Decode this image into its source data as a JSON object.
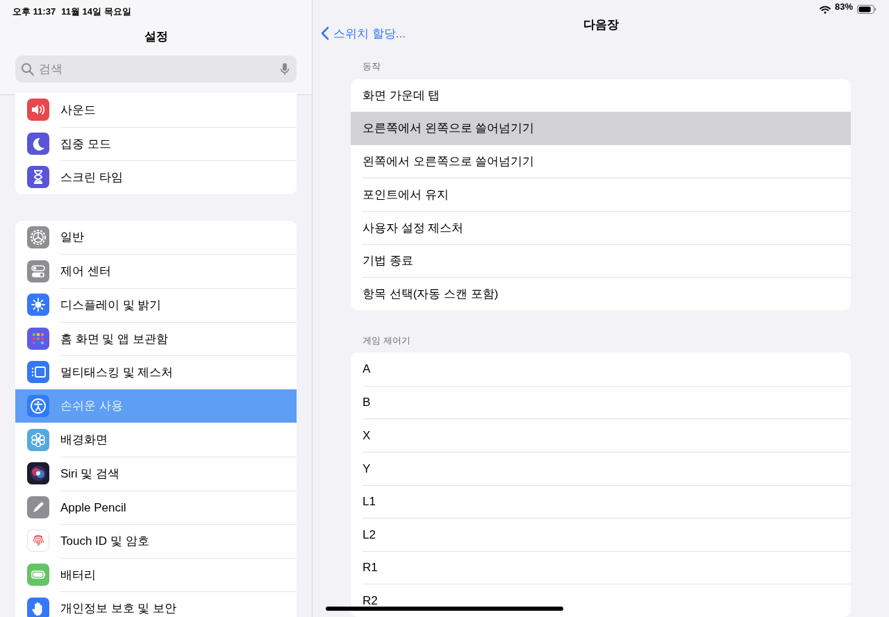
{
  "status_bar": {
    "time": "오후 11:37",
    "date": "11월 14일 목요일",
    "battery": "83%"
  },
  "sidebar": {
    "title": "설정",
    "search": {
      "placeholder": "검색"
    },
    "groups": [
      {
        "items": [
          {
            "label": "사운드",
            "selected": false
          },
          {
            "label": "집중 모드",
            "selected": false
          },
          {
            "label": "스크린 타임",
            "selected": false
          }
        ]
      },
      {
        "items": [
          {
            "label": "일반",
            "selected": false
          },
          {
            "label": "제어 센터",
            "selected": false
          },
          {
            "label": "디스플레이 및 밝기",
            "selected": false
          },
          {
            "label": "홈 화면 및 앱 보관함",
            "selected": false
          },
          {
            "label": "멀티태스킹 및 제스처",
            "selected": false
          },
          {
            "label": "손쉬운 사용",
            "selected": true
          },
          {
            "label": "배경화면",
            "selected": false
          },
          {
            "label": "Siri 및 검색",
            "selected": false
          },
          {
            "label": "Apple Pencil",
            "selected": false
          },
          {
            "label": "Touch ID 및 암호",
            "selected": false
          },
          {
            "label": "배터리",
            "selected": false
          },
          {
            "label": "개인정보 보호 및 보안",
            "selected": false
          }
        ]
      }
    ]
  },
  "detail": {
    "back": "스위치 할당...",
    "title": "다음장",
    "sections": [
      {
        "header": "동작",
        "rows": [
          {
            "label": "화면 가운데 탭",
            "selected": false
          },
          {
            "label": "오른쪽에서 왼쪽으로 쓸어넘기기",
            "selected": true
          },
          {
            "label": "왼쪽에서 오른쪽으로 쓸어넘기기",
            "selected": false
          },
          {
            "label": "포인트에서 유지",
            "selected": false
          },
          {
            "label": "사용자 설정 제스처",
            "selected": false
          },
          {
            "label": "기법 종료",
            "selected": false
          },
          {
            "label": "항목 선택(자동 스캔 포함)",
            "selected": false
          }
        ]
      },
      {
        "header": "게임 제어기",
        "rows": [
          {
            "label": "A",
            "selected": false
          },
          {
            "label": "B",
            "selected": false
          },
          {
            "label": "X",
            "selected": false
          },
          {
            "label": "Y",
            "selected": false
          },
          {
            "label": "L1",
            "selected": false
          },
          {
            "label": "L2",
            "selected": false
          },
          {
            "label": "R1",
            "selected": false
          },
          {
            "label": "R2",
            "selected": false
          }
        ]
      }
    ]
  }
}
